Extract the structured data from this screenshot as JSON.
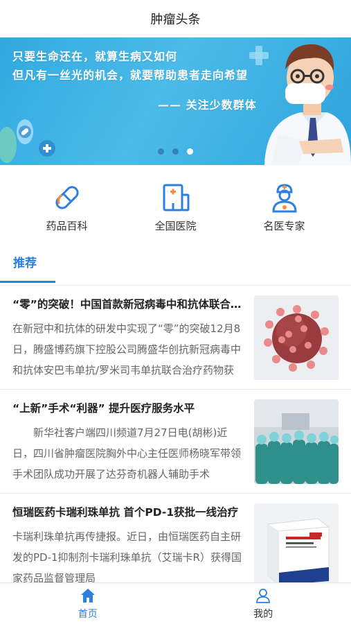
{
  "header": {
    "title": "肿瘤头条"
  },
  "banner": {
    "line1": "只要生命还在，就算生病又如何",
    "line2": "但凡有一丝光的机会，就要帮助患者走向希望",
    "signature": "—— 关注少数群体",
    "slide_count": 3,
    "active_slide": 3
  },
  "quicknav": [
    {
      "label": "药品百科",
      "icon": "pill-icon"
    },
    {
      "label": "全国医院",
      "icon": "hospital-icon"
    },
    {
      "label": "名医专家",
      "icon": "doctor-icon"
    }
  ],
  "tabs": {
    "active": "推荐"
  },
  "news": [
    {
      "title": "“零”的突破！中国首款新冠病毒中和抗体联合治疗药物获批上市",
      "summary": "在新冠中和抗体的研发中实现了“零”的突破12月8日，腾盛博药旗下控股公司腾盛华创抗新冠病毒中和抗体安巴韦单抗/罗米司韦单抗联合治疗药物获得国家药监局的应急批准",
      "thumb": "virus-image"
    },
    {
      "title": "“上新”手术“利器” 提升医疗服务水平",
      "summary": "　　新华社客户端四川频道7月27日电(胡彬)近日，四川省肿瘤医院胸外中心主任医师杨晓军带领手术团队成功开展了达芬奇机器人辅助手术",
      "thumb": "surgical-team-image"
    },
    {
      "title": "恒瑞医药卡瑞利珠单抗 首个PD-1获批一线治疗",
      "summary": "卡瑞利珠单抗再传捷报。近日，由恒瑞医药自主研发的PD-1抑制剂卡瑞利珠单抗（艾瑞卡R）获得国家药品监督管理局",
      "thumb": "medicine-box-image"
    }
  ],
  "tabbar": [
    {
      "label": "首页",
      "icon": "home-icon",
      "active": true
    },
    {
      "label": "我的",
      "icon": "user-icon",
      "active": false
    }
  ],
  "colors": {
    "accent": "#2d7fe0",
    "banner": "#3aaee2"
  }
}
